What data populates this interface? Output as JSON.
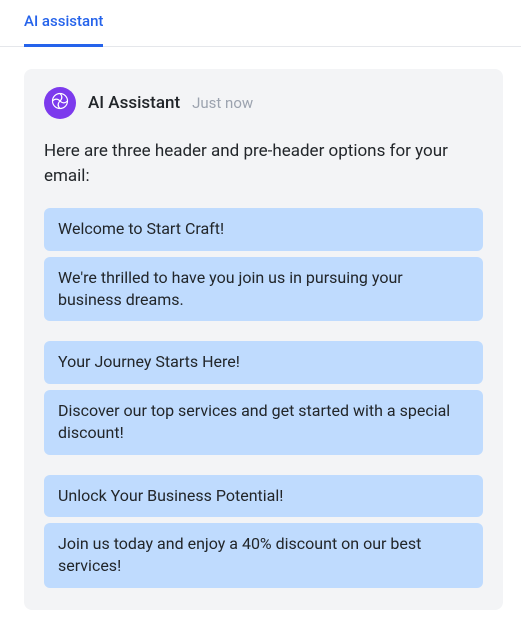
{
  "tabs": {
    "ai_assistant_label": "AI assistant"
  },
  "message": {
    "assistant_name": "AI Assistant",
    "timestamp": "Just now",
    "intro": "Here are three header and pre-header options for your email:",
    "options": [
      {
        "header": "Welcome to Start Craft!",
        "preheader": "We're thrilled to have you join us in pursuing your business dreams."
      },
      {
        "header": "Your Journey Starts Here!",
        "preheader": "Discover our top services and get started with a special discount!"
      },
      {
        "header": "Unlock Your Business Potential!",
        "preheader": "Join us today and enjoy a 40% discount on our best services!"
      }
    ]
  },
  "colors": {
    "accent": "#2563eb",
    "avatar": "#7c3aed",
    "option_bg": "#bfdbfe",
    "panel_bg": "#f3f4f6"
  }
}
